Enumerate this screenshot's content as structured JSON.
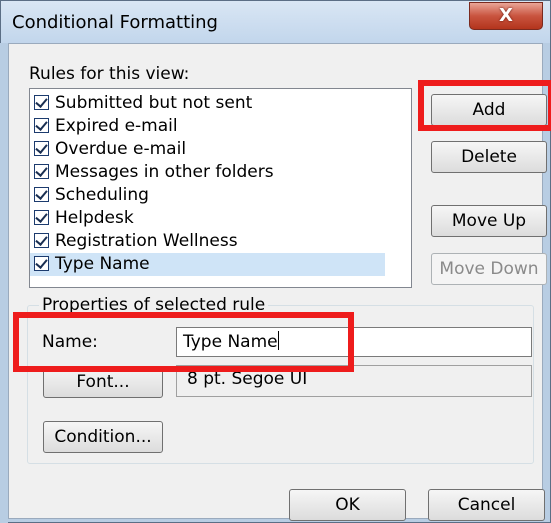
{
  "window": {
    "title": "Conditional Formatting",
    "close_glyph": "X"
  },
  "rules": {
    "label": "Rules for this view:",
    "items": [
      {
        "label": "Submitted but not sent",
        "checked": true
      },
      {
        "label": "Expired e-mail",
        "checked": true
      },
      {
        "label": "Overdue e-mail",
        "checked": true
      },
      {
        "label": "Messages in other folders",
        "checked": true
      },
      {
        "label": "Scheduling",
        "checked": true
      },
      {
        "label": "Helpdesk",
        "checked": true
      },
      {
        "label": "Registration Wellness",
        "checked": true
      },
      {
        "label": "Type Name",
        "checked": true,
        "selected": true
      }
    ]
  },
  "buttons": {
    "add": "Add",
    "delete": "Delete",
    "move_up": "Move Up",
    "move_down": "Move Down",
    "font": "Font...",
    "condition": "Condition...",
    "ok": "OK",
    "cancel": "Cancel"
  },
  "properties": {
    "group_title": "Properties of selected rule",
    "name_label": "Name:",
    "name_value": "Type Name",
    "font_value": "8 pt. Segoe UI"
  },
  "highlight_color": "#ee1c1c"
}
